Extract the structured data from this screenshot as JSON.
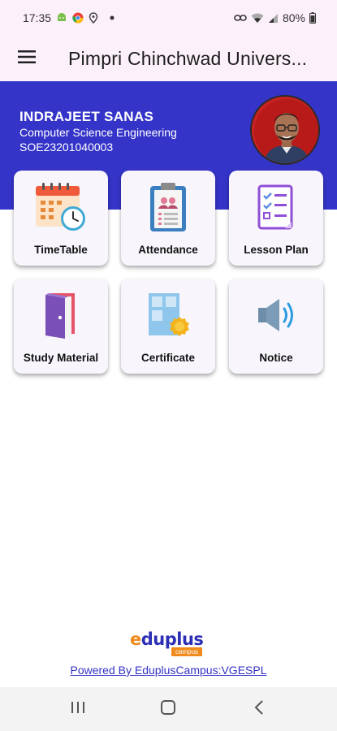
{
  "status_bar": {
    "time": "17:35",
    "battery": "80%",
    "icons": [
      "android-icon",
      "chrome-icon",
      "location-icon",
      "dot-icon",
      "link-icon",
      "wifi-icon",
      "signal-icon",
      "battery-icon"
    ]
  },
  "app_bar": {
    "title": "Pimpri Chinchwad Univers...",
    "menu_icon": "hamburger-menu-icon"
  },
  "profile": {
    "name": "INDRAJEET SANAS",
    "department": "Computer Science Engineering",
    "id": "SOE23201040003",
    "avatar_icon": "profile-avatar"
  },
  "colors": {
    "banner": "#3534c8",
    "app_bar_bg": "#fcf1fb",
    "tile_bg": "#f8f6fc",
    "link": "#3432c4",
    "brand_orange": "#f08a1c"
  },
  "tiles": [
    {
      "label": "TimeTable",
      "icon": "calendar-clock-icon"
    },
    {
      "label": "Attendance",
      "icon": "clipboard-icon"
    },
    {
      "label": "Lesson Plan",
      "icon": "checklist-icon"
    },
    {
      "label": "Study Material",
      "icon": "book-icon"
    },
    {
      "label": "Certificate",
      "icon": "certificate-icon"
    },
    {
      "label": "Notice",
      "icon": "speaker-icon"
    }
  ],
  "footer": {
    "logo_main": "duplus",
    "logo_letter": "e",
    "logo_sub": "campus",
    "powered_by": "Powered By EduplusCampus:VGESPL"
  },
  "nav_bar": [
    "recent-apps-icon",
    "home-icon",
    "back-icon"
  ]
}
